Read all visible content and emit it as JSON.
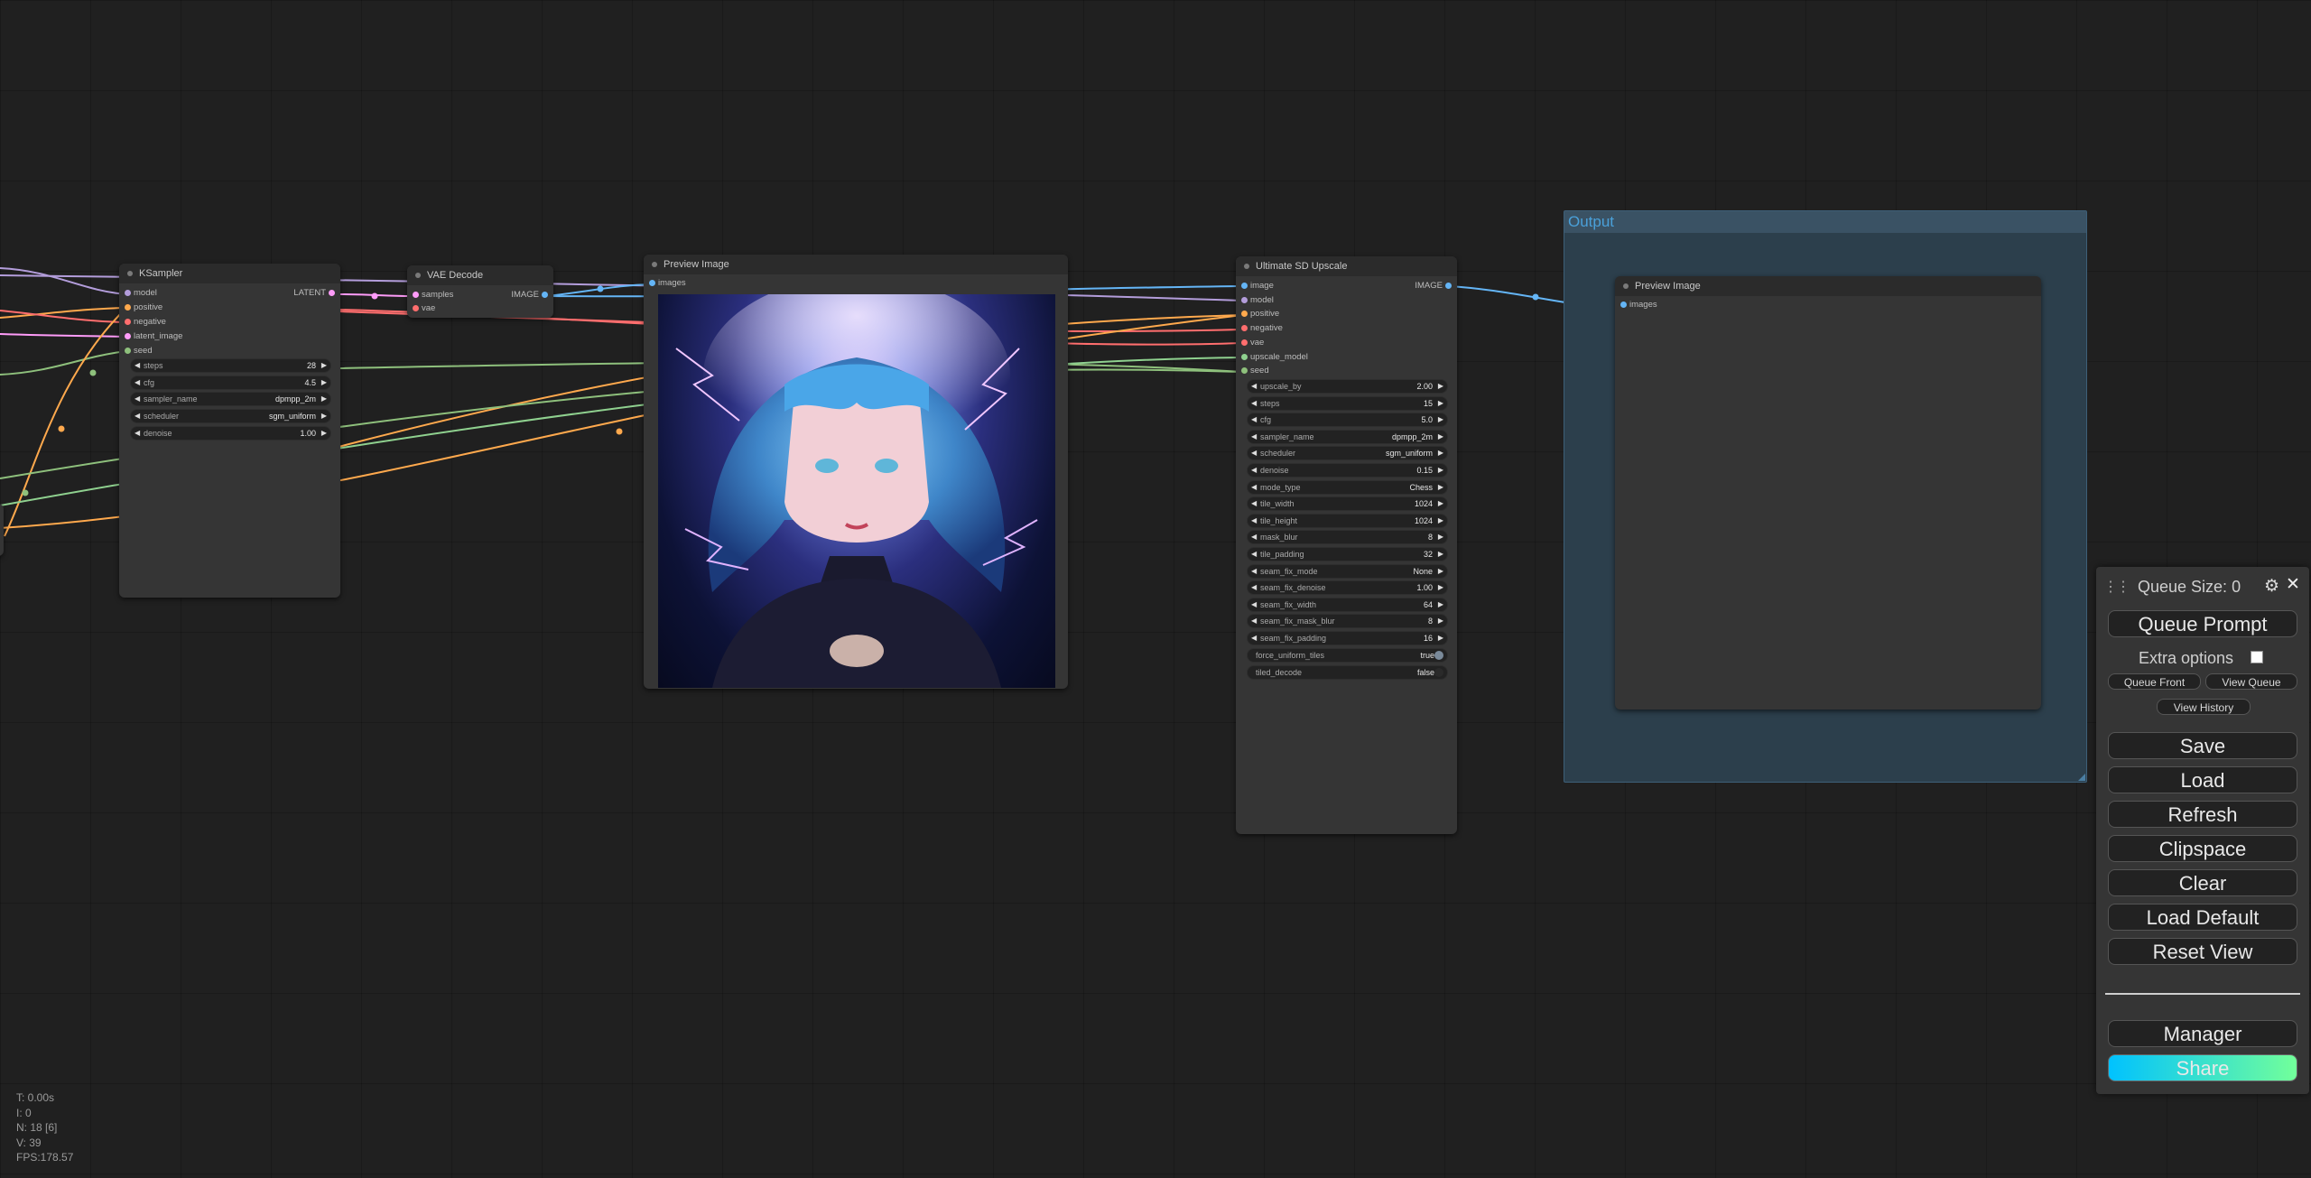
{
  "nodes": {
    "ksampler": {
      "title": "KSampler",
      "inputs": [
        "model",
        "positive",
        "negative",
        "latent_image",
        "seed"
      ],
      "output": "LATENT",
      "widgets": [
        {
          "name": "steps",
          "value": "28"
        },
        {
          "name": "cfg",
          "value": "4.5"
        },
        {
          "name": "sampler_name",
          "value": "dpmpp_2m"
        },
        {
          "name": "scheduler",
          "value": "sgm_uniform"
        },
        {
          "name": "denoise",
          "value": "1.00"
        }
      ]
    },
    "vae_decode": {
      "title": "VAE Decode",
      "inputs": [
        "samples",
        "vae"
      ],
      "output": "IMAGE"
    },
    "preview1": {
      "title": "Preview Image",
      "input": "images"
    },
    "upscale": {
      "title": "Ultimate SD Upscale",
      "inputs": [
        "image",
        "model",
        "positive",
        "negative",
        "vae",
        "upscale_model",
        "seed"
      ],
      "output": "IMAGE",
      "widgets": [
        {
          "name": "upscale_by",
          "value": "2.00"
        },
        {
          "name": "steps",
          "value": "15"
        },
        {
          "name": "cfg",
          "value": "5.0"
        },
        {
          "name": "sampler_name",
          "value": "dpmpp_2m"
        },
        {
          "name": "scheduler",
          "value": "sgm_uniform"
        },
        {
          "name": "denoise",
          "value": "0.15"
        },
        {
          "name": "mode_type",
          "value": "Chess"
        },
        {
          "name": "tile_width",
          "value": "1024"
        },
        {
          "name": "tile_height",
          "value": "1024"
        },
        {
          "name": "mask_blur",
          "value": "8"
        },
        {
          "name": "tile_padding",
          "value": "32"
        },
        {
          "name": "seam_fix_mode",
          "value": "None"
        },
        {
          "name": "seam_fix_denoise",
          "value": "1.00"
        },
        {
          "name": "seam_fix_width",
          "value": "64"
        },
        {
          "name": "seam_fix_mask_blur",
          "value": "8"
        },
        {
          "name": "seam_fix_padding",
          "value": "16"
        }
      ],
      "toggles": [
        {
          "name": "force_uniform_tiles",
          "value": "true"
        },
        {
          "name": "tiled_decode",
          "value": "false"
        }
      ]
    },
    "preview2": {
      "title": "Preview Image",
      "input": "images"
    }
  },
  "group": {
    "title": "Output"
  },
  "menu": {
    "queue_size": "Queue Size: 0",
    "queue_prompt": "Queue Prompt",
    "extra_options": "Extra options",
    "queue_front": "Queue Front",
    "view_queue": "View Queue",
    "view_history": "View History",
    "save": "Save",
    "load": "Load",
    "refresh": "Refresh",
    "clipspace": "Clipspace",
    "clear": "Clear",
    "load_default": "Load Default",
    "reset_view": "Reset View",
    "manager": "Manager",
    "share": "Share"
  },
  "stats": {
    "t": "T: 0.00s",
    "i": "I: 0",
    "n": "N: 18 [6]",
    "v": "V: 39",
    "fps": "FPS:178.57"
  },
  "colors": {
    "model": "#b39ddb",
    "positive": "#ffa94d",
    "negative": "#ff6e6e",
    "latent": "#ff9cf9",
    "seed": "#8ec07c",
    "image": "#64b5f6",
    "vae": "#ff6e6e",
    "upscale_model": "#8fd18f",
    "share_gradient_start": "#00c2ff",
    "share_gradient_end": "#72ff9a"
  }
}
